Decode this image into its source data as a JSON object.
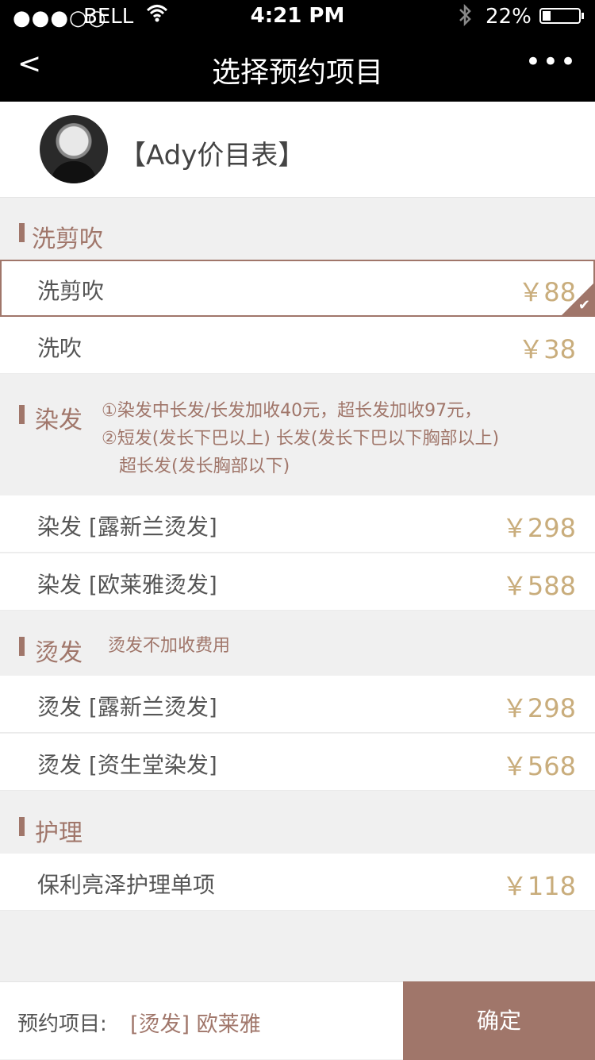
{
  "status_bar": {
    "signal": "●●●○○",
    "carrier": "BELL",
    "time": "4:21 PM",
    "battery_percent": "22%",
    "battery_level": 0.22
  },
  "nav": {
    "back": "<",
    "title": "选择预约项目",
    "more": "•••"
  },
  "profile": {
    "name": "【Ady价目表】"
  },
  "sections": [
    {
      "title": "洗剪吹",
      "items": [
        {
          "name": "洗剪吹",
          "price": "￥88",
          "selected": true
        },
        {
          "name": "洗吹",
          "price": "￥38",
          "selected": false
        }
      ]
    },
    {
      "title": "染发",
      "notes": [
        "①染发中长发/长发加收40元，超长发加收97元，",
        "②短发(发长下巴以上) 长发(发长下巴以下胸部以上)",
        "超长发(发长胸部以下)"
      ],
      "items": [
        {
          "name": "染发 [露新兰烫发]",
          "price": "￥298"
        },
        {
          "name": "染发 [欧莱雅烫发]",
          "price": "￥588"
        }
      ]
    },
    {
      "title": "烫发",
      "note": "烫发不加收费用",
      "items": [
        {
          "name": "烫发 [露新兰烫发]",
          "price": "￥298"
        },
        {
          "name": "烫发 [资生堂染发]",
          "price": "￥568"
        }
      ]
    },
    {
      "title": "护理",
      "items": [
        {
          "name": "保利亮泽护理单项",
          "price": "￥118"
        }
      ]
    }
  ],
  "footer": {
    "label": "预约项目:",
    "value": "[烫发] 欧莱雅",
    "confirm": "确定"
  },
  "colors": {
    "accent": "#a0766a",
    "price": "#c9ad7c",
    "nav_bg": "#000000"
  }
}
